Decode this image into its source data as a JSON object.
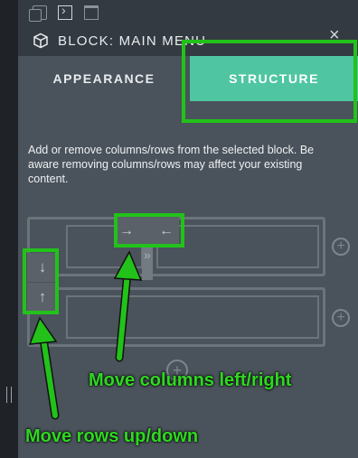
{
  "window": {
    "title": "BLOCK: MAIN MENU",
    "close_label": "×"
  },
  "toolbar": {
    "icons": [
      "copy-icon",
      "panel-toggle-icon",
      "save-icon"
    ]
  },
  "tabs": [
    {
      "label": "APPEARANCE",
      "active": false
    },
    {
      "label": "STRUCTURE",
      "active": true
    }
  ],
  "structure": {
    "description": "Add or remove columns/rows from the selected block. Be aware removing columns/rows may affect your existing content.",
    "controls": {
      "move_down": "↓",
      "move_up": "↑",
      "move_right": "→",
      "move_left": "←",
      "move_left_small": "«",
      "move_right_small": "»",
      "add": "+"
    }
  },
  "annotations": {
    "columns": "Move columns left/right",
    "rows": "Move rows up/down"
  },
  "colors": {
    "accent": "#4fc6a1",
    "highlight": "#22c21a",
    "panel": "#4a525b",
    "header": "#343a41"
  }
}
